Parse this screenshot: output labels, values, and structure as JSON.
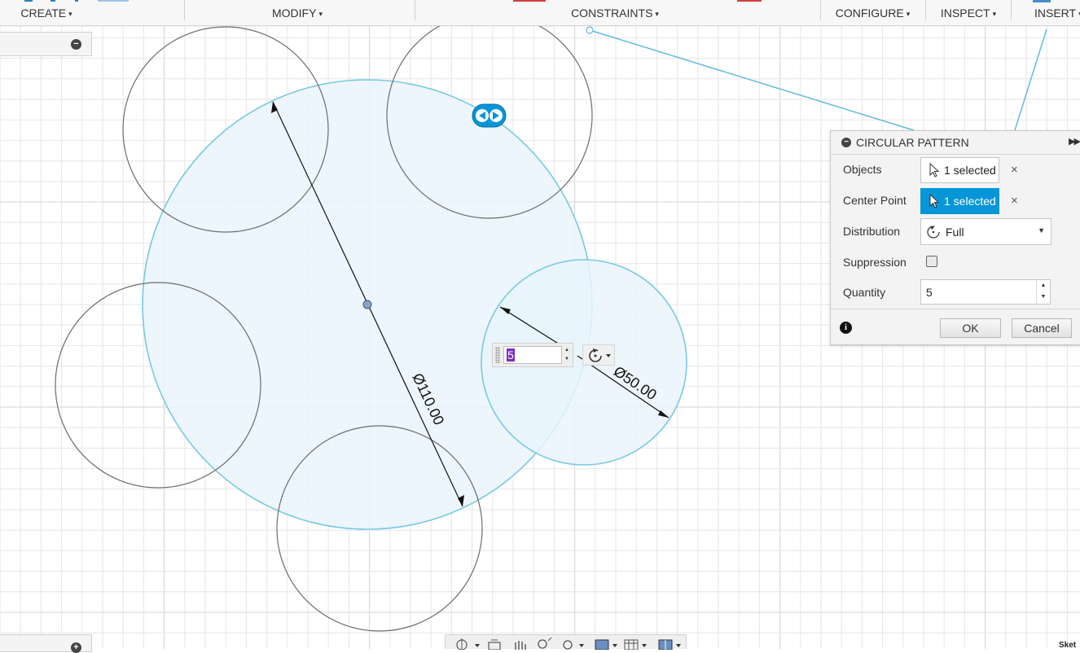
{
  "toolbar": {
    "groups": [
      {
        "label": "CREATE"
      },
      {
        "label": "MODIFY"
      },
      {
        "label": "CONSTRAINTS"
      },
      {
        "label": "CONFIGURE"
      },
      {
        "label": "INSPECT"
      },
      {
        "label": "INSERT"
      }
    ],
    "caret": "▾"
  },
  "sketch": {
    "dimension_large": "Ø110.00",
    "dimension_small": "Ø50.00",
    "inline_quantity": "5",
    "colors": {
      "grid": "#e6e6e6",
      "grid_major": "#d3d3d3",
      "selected_stroke": "#7ac8e2",
      "selected_fill": "#e9f5fb",
      "unselected_stroke": "#6d6d6d",
      "leader_line": "#64b8e0",
      "glyph_blue": "#0696d7"
    }
  },
  "panel": {
    "title": "CIRCULAR PATTERN",
    "objects_label": "Objects",
    "objects_value": "1 selected",
    "center_label": "Center Point",
    "center_value": "1 selected",
    "distribution_label": "Distribution",
    "distribution_value": "Full",
    "suppression_label": "Suppression",
    "suppression_checked": false,
    "quantity_label": "Quantity",
    "quantity_value": "5",
    "ok_label": "OK",
    "cancel_label": "Cancel",
    "clear_glyph": "×",
    "active_color": "#0696d7"
  },
  "status": {
    "bottom_right_label": "Sket"
  }
}
